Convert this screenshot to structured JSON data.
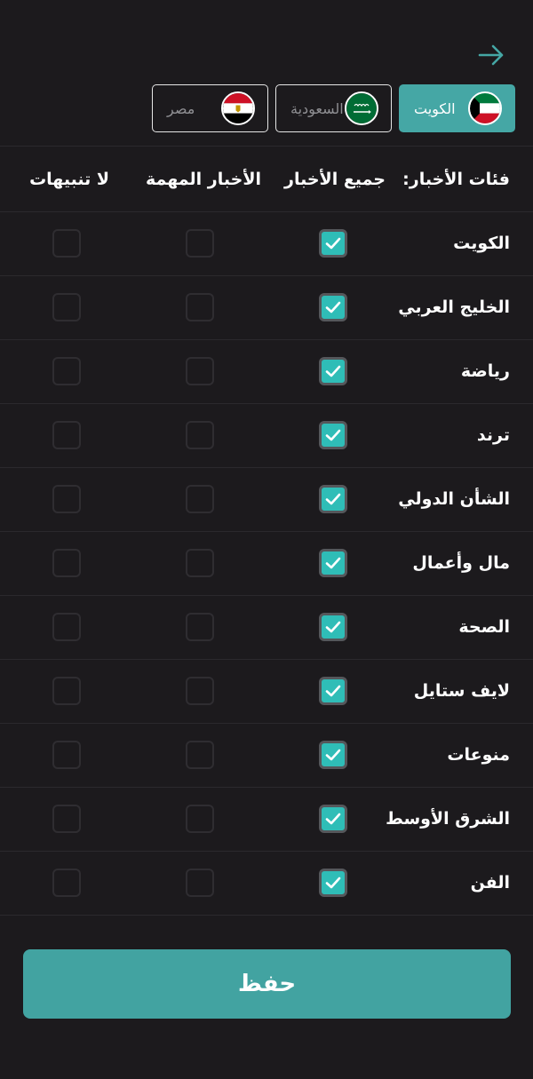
{
  "header": {
    "back_icon": "arrow-right-icon"
  },
  "country_tabs": [
    {
      "label": "الكويت",
      "flag_icon": "kuwait-flag-icon",
      "active": true
    },
    {
      "label": "السعودية",
      "flag_icon": "saudi-flag-icon",
      "active": false
    },
    {
      "label": "مصر",
      "flag_icon": "egypt-flag-icon",
      "active": false
    }
  ],
  "table": {
    "columns": {
      "category": "فئات الأخبار:",
      "all_news": "جميع الأخبار",
      "important_news": "الأخبار المهمة",
      "no_notifications": "لا تنبيهات"
    },
    "rows": [
      {
        "label": "الكويت",
        "all_news": true,
        "important_news": false,
        "no_notifications": false
      },
      {
        "label": "الخليج العربي",
        "all_news": true,
        "important_news": false,
        "no_notifications": false
      },
      {
        "label": "رياضة",
        "all_news": true,
        "important_news": false,
        "no_notifications": false
      },
      {
        "label": "ترند",
        "all_news": true,
        "important_news": false,
        "no_notifications": false
      },
      {
        "label": "الشأن الدولي",
        "all_news": true,
        "important_news": false,
        "no_notifications": false
      },
      {
        "label": "مال وأعمال",
        "all_news": true,
        "important_news": false,
        "no_notifications": false
      },
      {
        "label": "الصحة",
        "all_news": true,
        "important_news": false,
        "no_notifications": false
      },
      {
        "label": "لايف ستايل",
        "all_news": true,
        "important_news": false,
        "no_notifications": false
      },
      {
        "label": "منوعات",
        "all_news": true,
        "important_news": false,
        "no_notifications": false
      },
      {
        "label": "الشرق الأوسط",
        "all_news": true,
        "important_news": false,
        "no_notifications": false
      },
      {
        "label": "الفن",
        "all_news": true,
        "important_news": false,
        "no_notifications": false
      }
    ]
  },
  "save_button": {
    "label": "حفظ"
  },
  "colors": {
    "background": "#1c1a1d",
    "accent": "#45a7a5",
    "checkbox_checked": "#2fbdb7",
    "divider": "#2b292d"
  }
}
